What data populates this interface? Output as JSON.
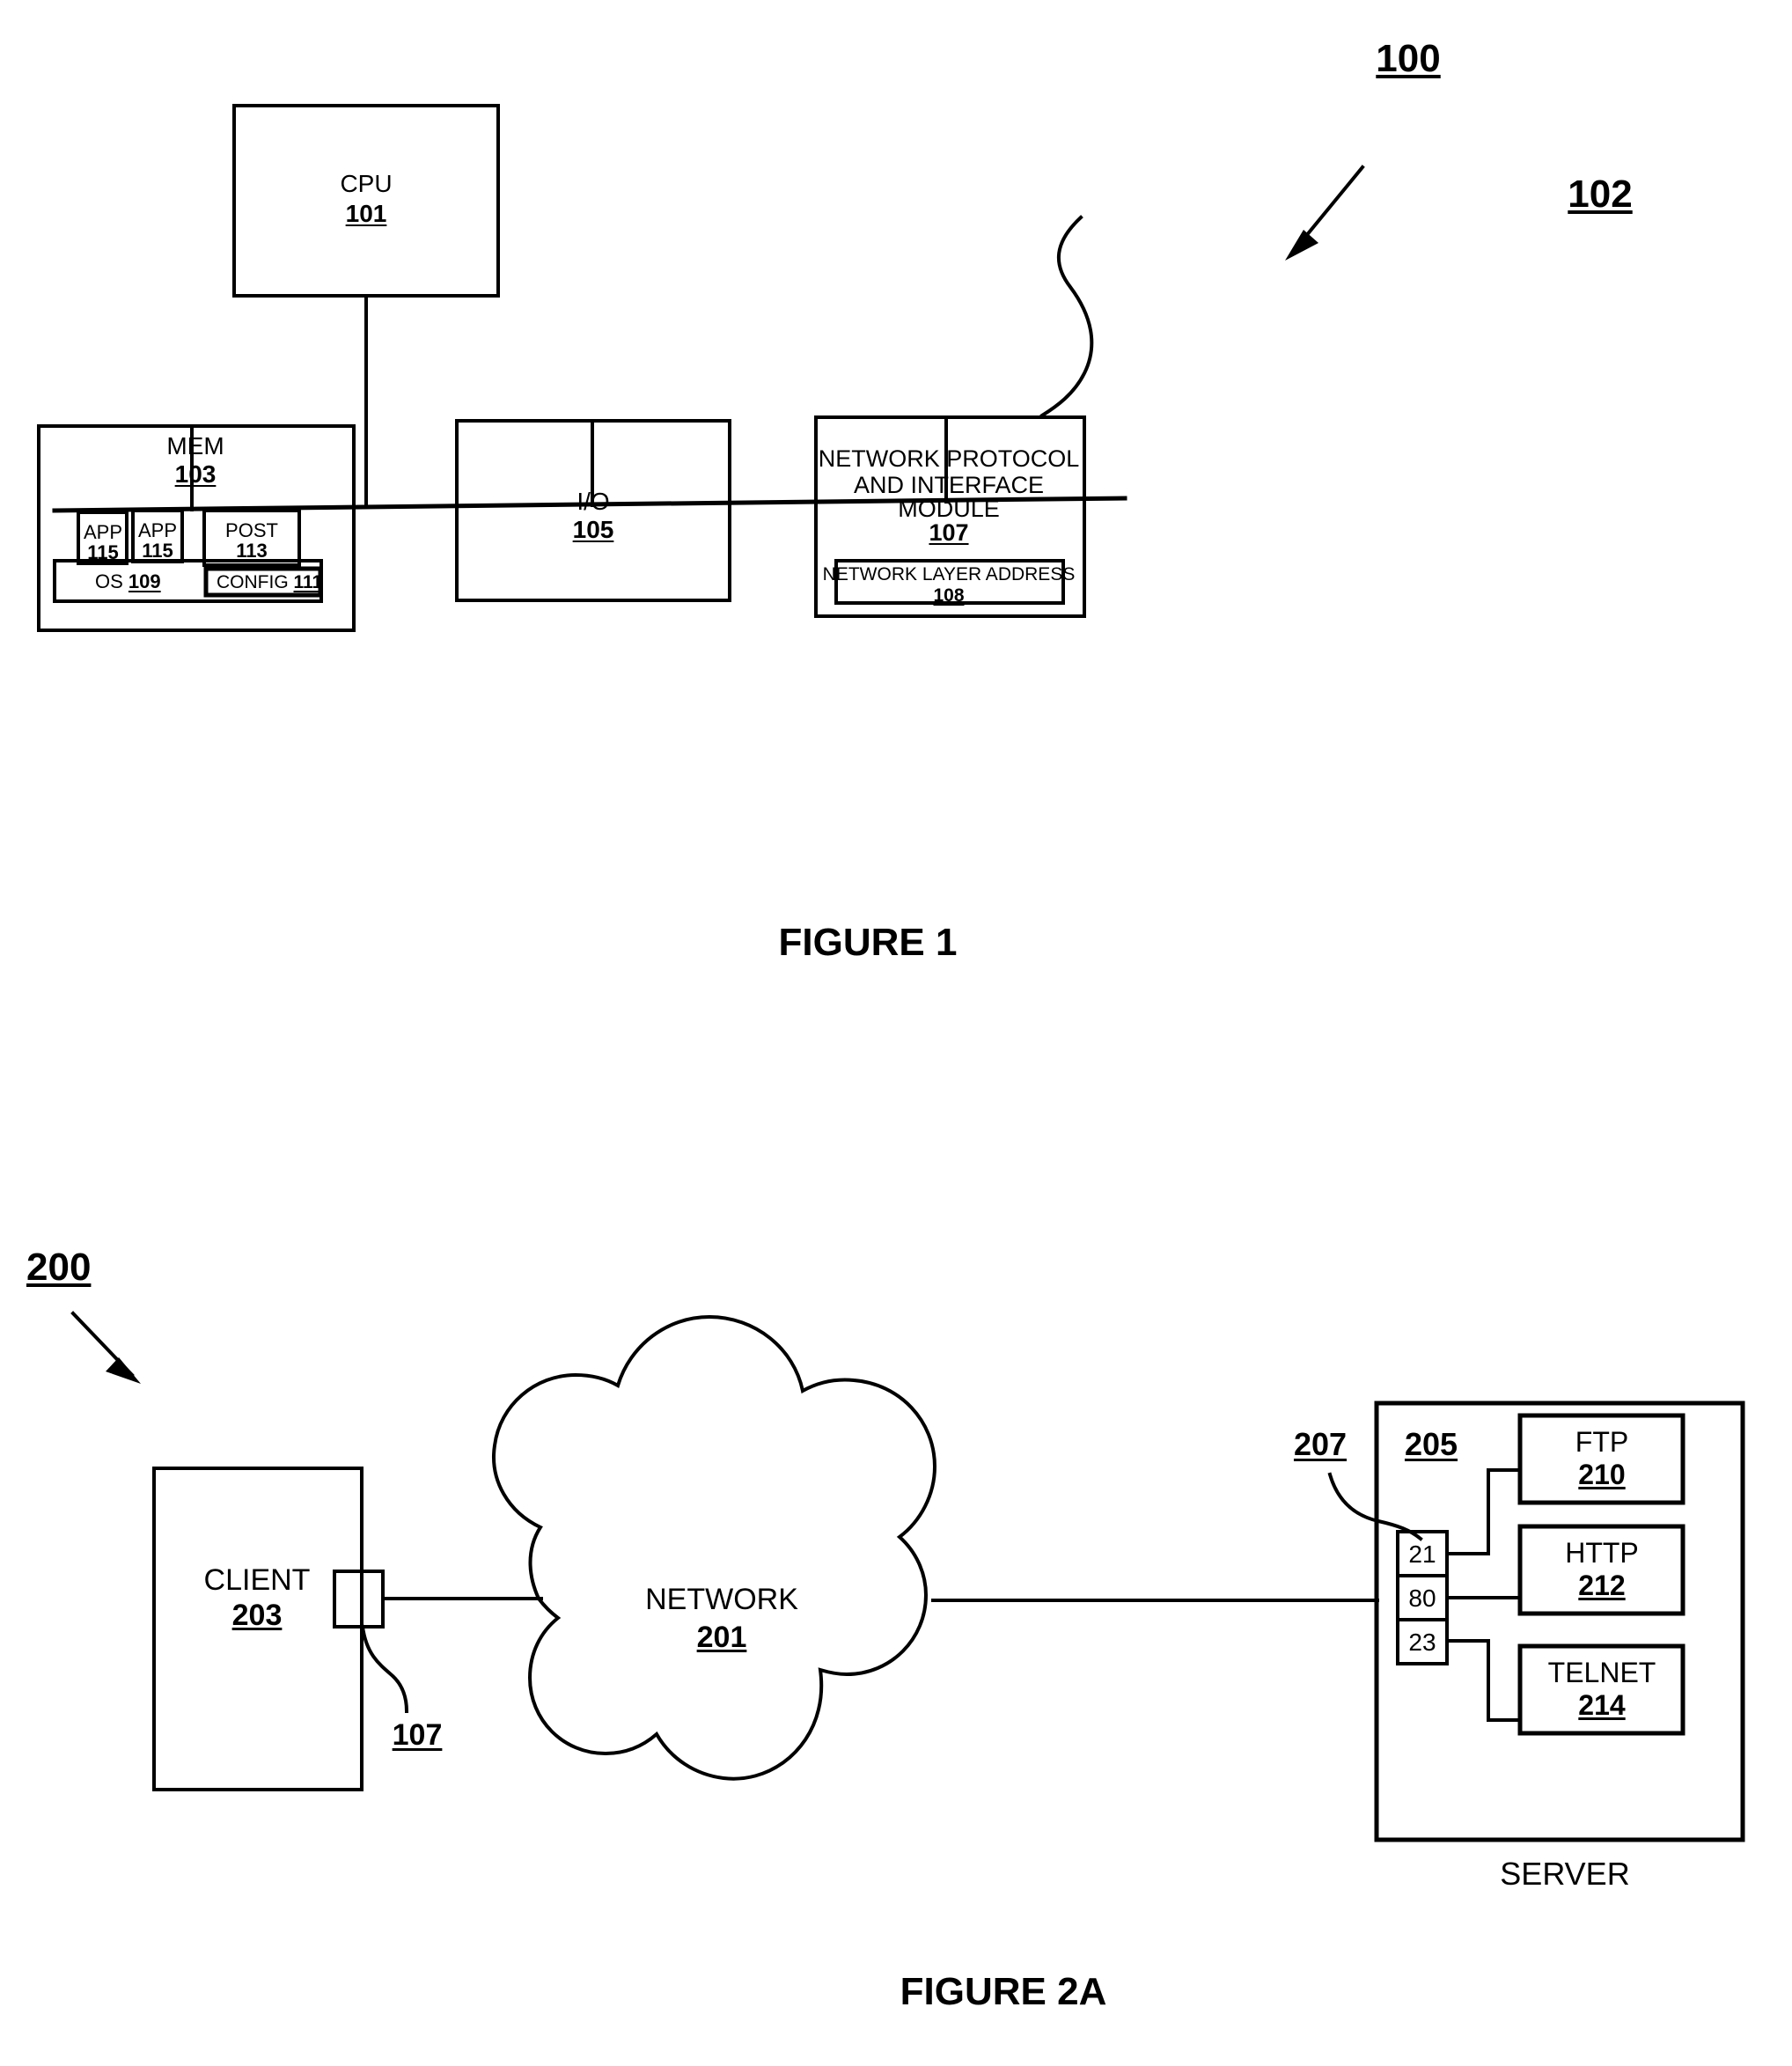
{
  "figure1": {
    "system_ref": "100",
    "bus_ref": "102",
    "caption": "FIGURE 1",
    "cpu": {
      "label": "CPU",
      "ref": "101"
    },
    "mem": {
      "label": "MEM",
      "ref": "103",
      "app1": {
        "label": "APP",
        "ref": "115"
      },
      "app2": {
        "label": "APP",
        "ref": "115"
      },
      "post": {
        "label": "POST",
        "ref": "113"
      },
      "os": {
        "label": "OS",
        "ref": "109"
      },
      "config": {
        "label": "CONFIG",
        "ref": "111"
      }
    },
    "io": {
      "label": "I/O",
      "ref": "105"
    },
    "netmod": {
      "line1": "NETWORK PROTOCOL",
      "line2": "AND INTERFACE",
      "line3": "MODULE",
      "ref": "107",
      "address": {
        "label": "NETWORK LAYER ADDRESS",
        "ref": "108"
      }
    }
  },
  "figure2a": {
    "system_ref": "200",
    "caption": "FIGURE 2A",
    "client": {
      "label": "CLIENT",
      "ref": "203"
    },
    "client_iface_ref": "107",
    "network": {
      "label": "NETWORK",
      "ref": "201"
    },
    "ports_ref": "207",
    "server": {
      "label": "SERVER",
      "ref": "205",
      "ports": [
        "21",
        "80",
        "23"
      ],
      "services": [
        {
          "label": "FTP",
          "ref": "210"
        },
        {
          "label": "HTTP",
          "ref": "212"
        },
        {
          "label": "TELNET",
          "ref": "214"
        }
      ]
    }
  },
  "colors": {
    "ink": "#000000",
    "paper": "#ffffff"
  }
}
